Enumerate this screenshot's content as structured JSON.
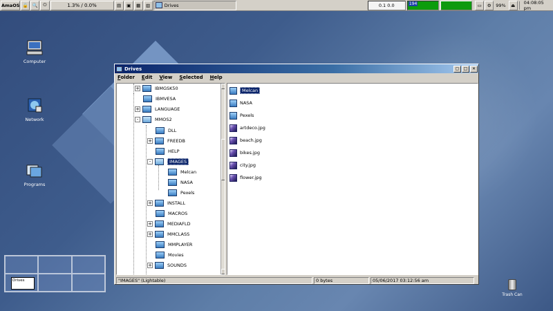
{
  "taskbar": {
    "logo_text": "AmaOS",
    "cpu_text": "1.3% / 0.0%",
    "task_label": "Drives",
    "net_text": "0.1 0.0",
    "mem_value": "194",
    "battery_text": "99%",
    "clock": "04:08:05 pm",
    "icons": [
      "app-menu-icon",
      "lock-icon",
      "search-icon",
      "power-icon",
      "windowlist-icon",
      "drives-icon",
      "folder-icon",
      "disk-icon",
      "eject-icon"
    ]
  },
  "desktop_icons": [
    {
      "label": "Computer",
      "icon": "computer-icon"
    },
    {
      "label": "Network",
      "icon": "network-icon"
    },
    {
      "label": "Programs",
      "icon": "programs-icon"
    }
  ],
  "window": {
    "title": "Drives",
    "menu": [
      "Folder",
      "Edit",
      "View",
      "Selected",
      "Help"
    ],
    "tree": [
      {
        "label": "IBMGSK50",
        "expander": "+"
      },
      {
        "label": "IBMVESA",
        "expander": ""
      },
      {
        "label": "LANGUAGE",
        "expander": "+"
      },
      {
        "label": "MMOS2",
        "expander": "-"
      },
      {
        "label": "DLL",
        "expander": ""
      },
      {
        "label": "FREEDB",
        "expander": "+"
      },
      {
        "label": "HELP",
        "expander": ""
      },
      {
        "label": "IMAGES",
        "expander": "-",
        "selected": true
      },
      {
        "label": "Melcan",
        "expander": ""
      },
      {
        "label": "NASA",
        "expander": ""
      },
      {
        "label": "Pexels",
        "expander": ""
      },
      {
        "label": "INSTALL",
        "expander": "+"
      },
      {
        "label": "MACROS",
        "expander": ""
      },
      {
        "label": "MEDIAFLD",
        "expander": "+"
      },
      {
        "label": "MMCLASS",
        "expander": "+"
      },
      {
        "label": "MMPLAYER",
        "expander": ""
      },
      {
        "label": "Movies",
        "expander": ""
      },
      {
        "label": "SOUNDS",
        "expander": "+"
      }
    ],
    "files": [
      {
        "name": "Melcan",
        "type": "folder",
        "selected": true
      },
      {
        "name": "NASA",
        "type": "folder"
      },
      {
        "name": "Pexels",
        "type": "folder"
      },
      {
        "name": "artdeco.jpg",
        "type": "image"
      },
      {
        "name": "beach.jpg",
        "type": "image"
      },
      {
        "name": "bikes.jpg",
        "type": "image"
      },
      {
        "name": "city.jpg",
        "type": "image"
      },
      {
        "name": "flower.jpg",
        "type": "image"
      }
    ],
    "status": {
      "selection": "\"IMAGES\" (Lightable)",
      "size": "0 bytes",
      "date": "05/06/2017 03:12:56 am"
    }
  },
  "pager": {
    "window_label": "Drives"
  },
  "trash": {
    "label": "Trash Can"
  }
}
